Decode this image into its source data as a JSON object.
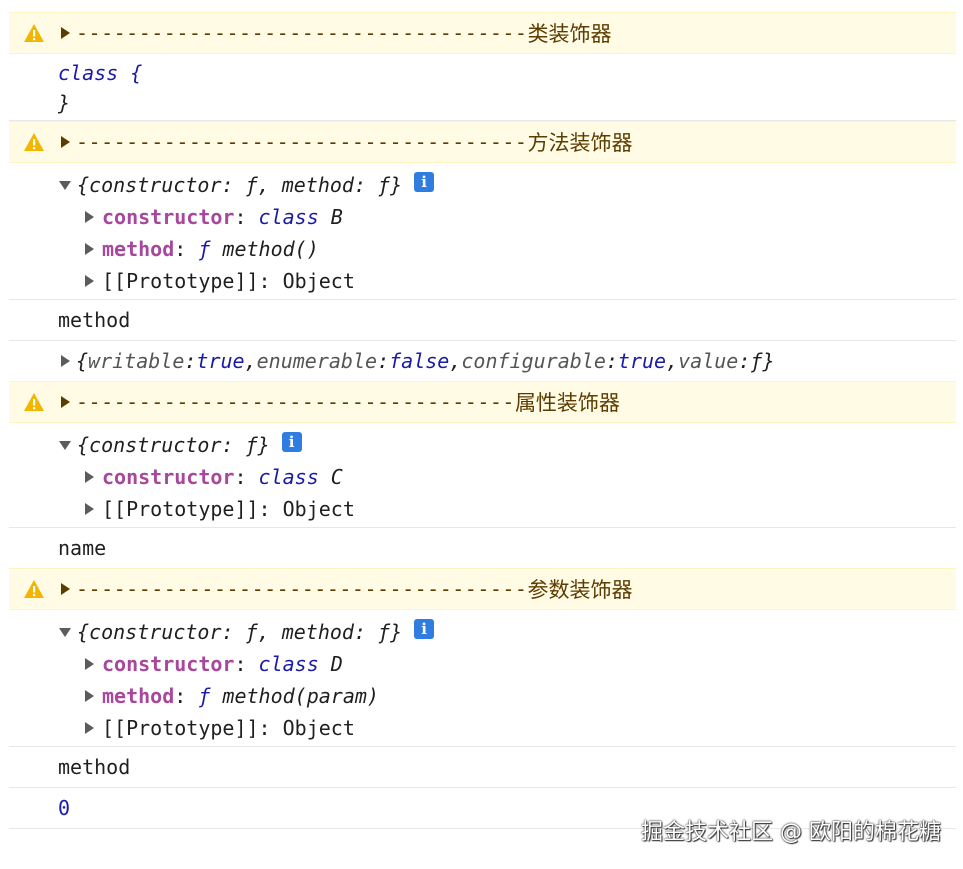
{
  "console": {
    "warnings": [
      {
        "dashes": "------------------------------------",
        "label": "类装饰器"
      },
      {
        "dashes": "------------------------------------",
        "label": "方法装饰器"
      },
      {
        "dashes": "-----------------------------------",
        "label": "属性装饰器"
      },
      {
        "dashes": "------------------------------------",
        "label": "参数装饰器"
      }
    ],
    "class_output": {
      "line1": "class {",
      "line2": "}"
    },
    "method_group": {
      "summary": "{constructor: ƒ, method: ƒ}",
      "info": "i",
      "constructor_key": "constructor",
      "constructor_sep": ": ",
      "constructor_kw": "class",
      "constructor_val": " B",
      "method_key": "method",
      "method_sep": ": ",
      "method_f": "ƒ",
      "method_val": " method()",
      "prototype": "[[Prototype]]: Object",
      "name_log": "method",
      "descriptor": {
        "open": "{",
        "k1": "writable",
        "v1": "true",
        "k2": "enumerable",
        "v2": "false",
        "k3": "configurable",
        "v3": "true",
        "k4": "value",
        "v4": "ƒ",
        "close": "}"
      }
    },
    "property_group": {
      "summary": "{constructor: ƒ}",
      "info": "i",
      "constructor_key": "constructor",
      "constructor_sep": ": ",
      "constructor_kw": "class",
      "constructor_val": " C",
      "prototype": "[[Prototype]]: Object",
      "name_log": "name"
    },
    "param_group": {
      "summary": "{constructor: ƒ, method: ƒ}",
      "info": "i",
      "constructor_key": "constructor",
      "constructor_sep": ": ",
      "constructor_kw": "class",
      "constructor_val": " D",
      "method_key": "method",
      "method_sep": ": ",
      "method_f": "ƒ",
      "method_val": " method(param)",
      "prototype": "[[Prototype]]: Object",
      "name_log": "method",
      "index_log": "0"
    }
  },
  "watermark": "掘金技术社区 @ 欧阳的棉花糖",
  "colors": {
    "warning_bg": "#fffbe5",
    "warning_text": "#5c3c00",
    "key": "#a7489c",
    "keyword": "#1a1aa6",
    "info_badge": "#2f7de1"
  }
}
